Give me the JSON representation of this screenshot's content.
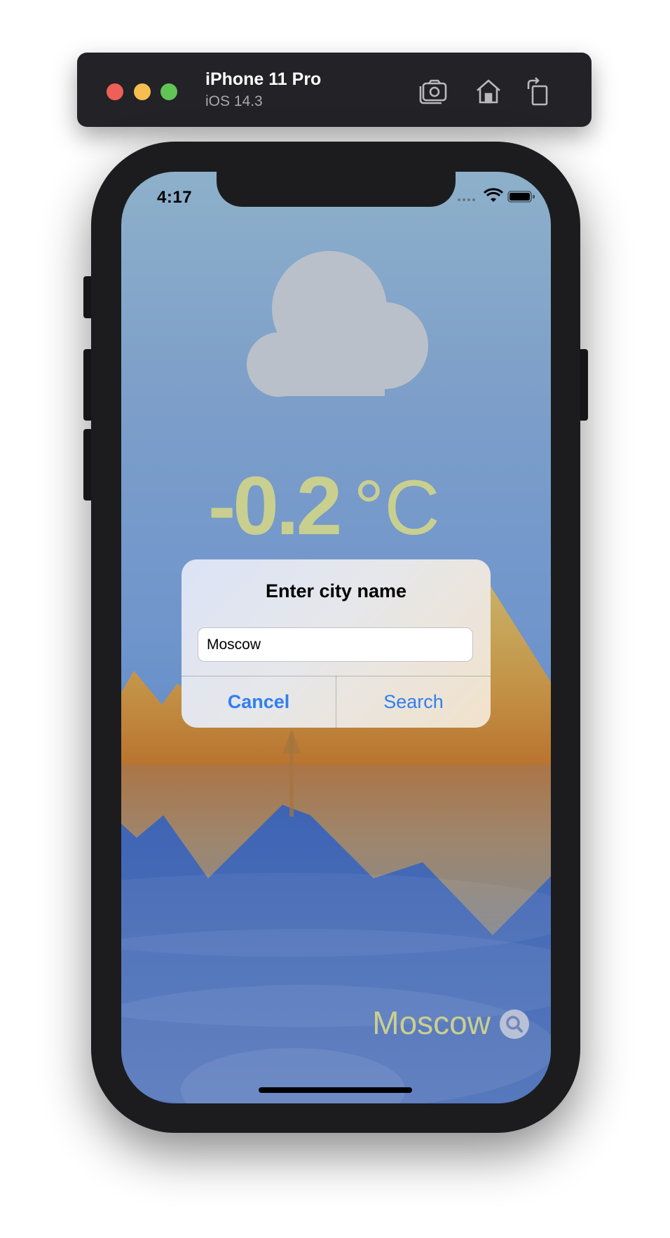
{
  "simulator": {
    "device_name": "iPhone 11 Pro",
    "os_version": "iOS 14.3",
    "toolbar_icons": [
      "screenshot-icon",
      "home-icon",
      "rotate-icon"
    ]
  },
  "status_bar": {
    "time": "4:17",
    "icons": [
      "cellular-signal-icon",
      "wifi-icon",
      "battery-icon"
    ]
  },
  "weather": {
    "condition_icon": "cloud-icon",
    "temperature": "-0.2",
    "unit": "°C",
    "city": "Moscow"
  },
  "alert": {
    "title": "Enter city name",
    "field_value": "Moscow",
    "cancel_label": "Cancel",
    "search_label": "Search"
  },
  "colors": {
    "accent_text": "#c9cf8f",
    "alert_button": "#2f7ff2",
    "sky_top": "#8db0ca",
    "water": "#3b5fb0"
  }
}
